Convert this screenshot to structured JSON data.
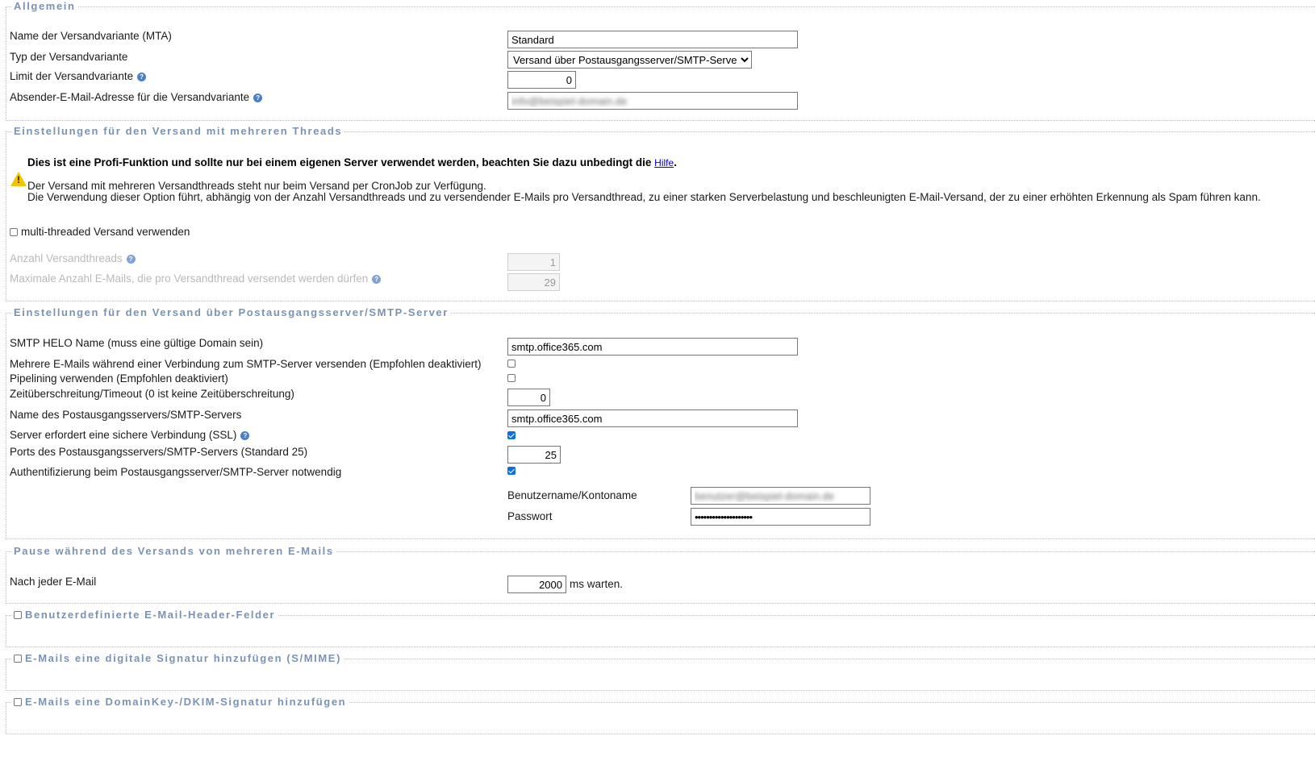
{
  "allgemein": {
    "legend": "Allgemein",
    "name_label": "Name der Versandvariante (MTA)",
    "name_value": "Standard",
    "typ_label": "Typ der Versandvariante",
    "typ_value": "Versand über Postausgangsserver/SMTP-Server",
    "limit_label": "Limit der Versandvariante",
    "limit_value": "0",
    "absender_label": "Absender-E-Mail-Adresse für die Versandvariante",
    "absender_value": "info@beispiel-domain.de"
  },
  "threads": {
    "legend": "Einstellungen für den Versand mit mehreren Threads",
    "warning_bold": "Dies ist eine Profi-Funktion und sollte nur bei einem eigenen Server verwendet werden, beachten Sie dazu unbedingt die",
    "warning_link": "Hilfe",
    "warning_line2": "Der Versand mit mehreren Versandthreads steht nur beim Versand per CronJob zur Verfügung.",
    "warning_line3": "Die Verwendung dieser Option führt, abhängig von der Anzahl Versandthreads und zu versendender E-Mails pro Versandthread, zu einer starken Serverbelastung und beschleunigten E-Mail-Versand, der zu einer erhöhten Erkennung als Spam führen kann.",
    "multi_label": "multi-threaded Versand verwenden",
    "multi_checked": false,
    "anzahl_label": "Anzahl Versandthreads",
    "anzahl_value": "1",
    "max_label": "Maximale Anzahl E-Mails, die pro Versandthread versendet werden dürfen",
    "max_value": "29"
  },
  "smtp": {
    "legend": "Einstellungen für den Versand über Postausgangsserver/SMTP-Server",
    "helo_label": "SMTP HELO Name (muss eine gültige Domain sein)",
    "helo_value": "smtp.office365.com",
    "mehrere_label": "Mehrere E-Mails während einer Verbindung zum SMTP-Server versenden (Empfohlen deaktiviert)",
    "mehrere_checked": false,
    "pipelining_label": "Pipelining verwenden (Empfohlen deaktiviert)",
    "pipelining_checked": false,
    "timeout_label": "Zeitüberschreitung/Timeout (0 ist keine Zeitüberschreitung)",
    "timeout_value": "0",
    "server_label": "Name des Postausgangsservers/SMTP-Servers",
    "server_value": "smtp.office365.com",
    "ssl_label": "Server erfordert eine sichere Verbindung (SSL)",
    "ssl_checked": true,
    "ports_label": "Ports des Postausgangsservers/SMTP-Servers (Standard 25)",
    "ports_value": "25",
    "auth_label": "Authentifizierung beim Postausgangsserver/SMTP-Server notwendig",
    "auth_checked": true,
    "user_label": "Benutzername/Kontoname",
    "user_value": "benutzer@beispiel-domain.de",
    "pass_label": "Passwort",
    "pass_value": "••••••••••••••••••••"
  },
  "pause": {
    "legend": "Pause während des Versands von mehreren E-Mails",
    "label": "Nach jeder E-Mail",
    "value": "2000",
    "suffix": "ms warten."
  },
  "collapsed": [
    {
      "legend": "Benutzerdefinierte E-Mail-Header-Felder",
      "checked": false
    },
    {
      "legend": "E-Mails eine digitale Signatur hinzufügen (S/MIME)",
      "checked": false
    },
    {
      "legend": "E-Mails eine DomainKey-/DKIM-Signatur hinzufügen",
      "checked": false
    }
  ]
}
